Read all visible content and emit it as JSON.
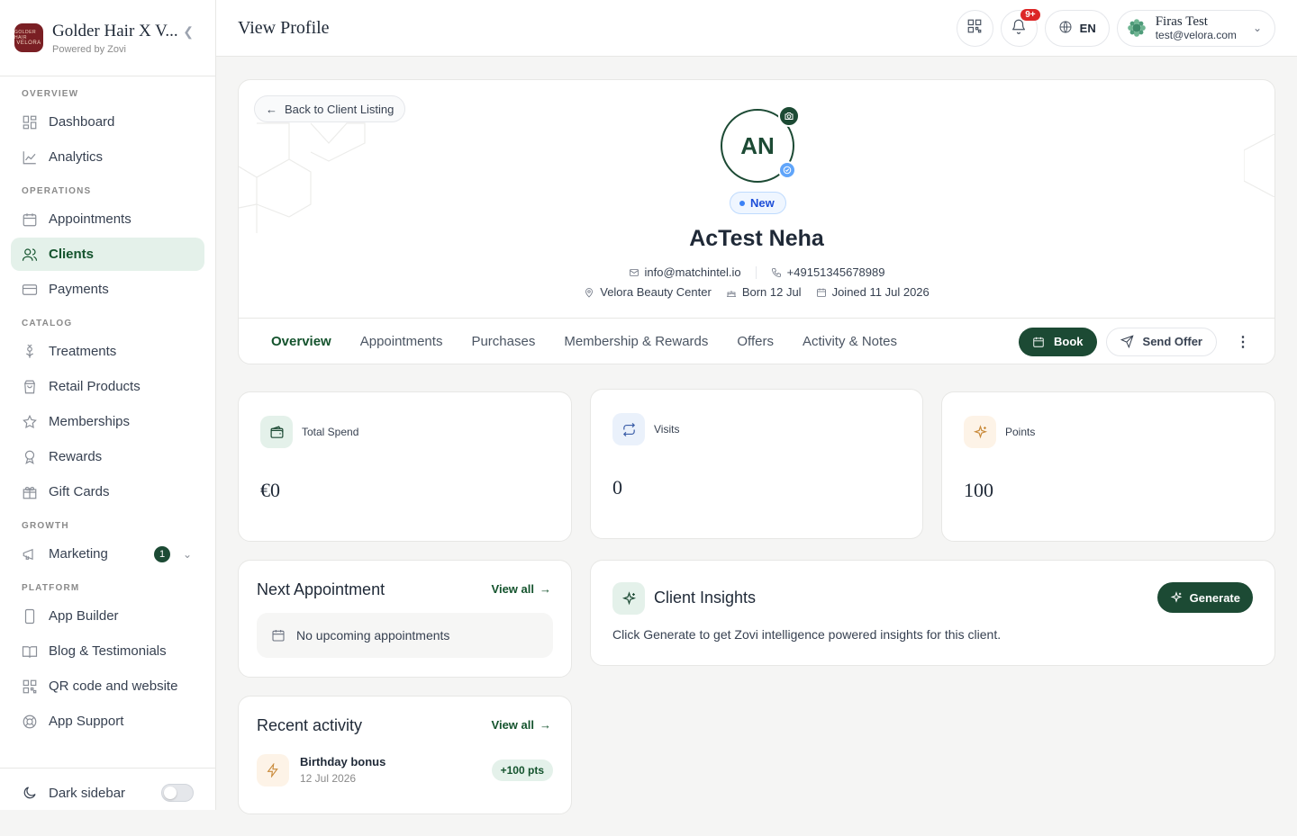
{
  "brand": {
    "logo_text_top": "GOLDER HAIR",
    "logo_text_bottom": "VELORA",
    "title": "Golder Hair X V...",
    "subtitle": "Powered by Zovi"
  },
  "sidebar": {
    "sections": {
      "overview": "OVERVIEW",
      "operations": "OPERATIONS",
      "catalog": "CATALOG",
      "growth": "GROWTH",
      "platform": "PLATFORM"
    },
    "items": {
      "dashboard": "Dashboard",
      "analytics": "Analytics",
      "appointments": "Appointments",
      "clients": "Clients",
      "payments": "Payments",
      "treatments": "Treatments",
      "retail_products": "Retail Products",
      "memberships": "Memberships",
      "rewards": "Rewards",
      "gift_cards": "Gift Cards",
      "marketing": "Marketing",
      "marketing_badge": "1",
      "app_builder": "App Builder",
      "blog": "Blog & Testimonials",
      "qr": "QR code and website",
      "app_support": "App Support"
    },
    "dark_sidebar": "Dark sidebar"
  },
  "header": {
    "title": "View Profile",
    "notif_badge": "9+",
    "language": "EN",
    "user_name": "Firas Test",
    "user_email": "test@velora.com"
  },
  "profile": {
    "back_label": "Back to Client Listing",
    "initials": "AN",
    "status": "New",
    "name": "AcTest Neha",
    "email": "info@matchintel.io",
    "phone": "+49151345678989",
    "location": "Velora Beauty Center",
    "born": "Born 12 Jul",
    "joined": "Joined 11 Jul 2026"
  },
  "tabs": [
    "Overview",
    "Appointments",
    "Purchases",
    "Membership & Rewards",
    "Offers",
    "Activity & Notes"
  ],
  "actions": {
    "book": "Book",
    "send_offer": "Send Offer"
  },
  "stats": {
    "total_spend_label": "Total Spend",
    "total_spend_value": "€0",
    "visits_label": "Visits",
    "visits_value": "0",
    "points_label": "Points",
    "points_value": "100"
  },
  "next_appointment": {
    "title": "Next Appointment",
    "view_all": "View all",
    "empty": "No upcoming appointments"
  },
  "recent_activity": {
    "title": "Recent activity",
    "view_all": "View all",
    "item_title": "Birthday bonus",
    "item_date": "12 Jul 2026",
    "item_points": "+100 pts"
  },
  "insights": {
    "title": "Client Insights",
    "text": "Click Generate to get Zovi intelligence powered insights for this client.",
    "button": "Generate"
  },
  "colors": {
    "brand_green": "#1c4a34",
    "active_bg": "#e4f1ea",
    "status_blue": "#3b82f6",
    "notif_red": "#dc2626"
  }
}
